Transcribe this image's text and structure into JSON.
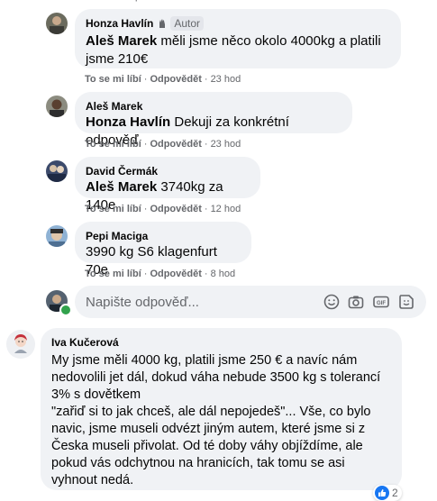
{
  "top_fragment": "p",
  "comments": [
    {
      "author": "Honza Havlín",
      "badge": "Autor",
      "mention": "Aleš Marek",
      "text": "měli jsme něco okolo 4000kg a platili jsme 210€",
      "like": "To se mi líbí",
      "reply": "Odpovědět",
      "time": "23 hod"
    },
    {
      "author": "Aleš Marek",
      "mention": "Honza Havlín",
      "text": "Dekuji za konkrétní odpověď",
      "like": "To se mi líbí",
      "reply": "Odpovědět",
      "time": "23 hod"
    },
    {
      "author": "David Čermák",
      "mention": "Aleš Marek",
      "text": "3740kg za 140e",
      "like": "To se mi líbí",
      "reply": "Odpovědět",
      "time": "12 hod"
    },
    {
      "author": "Pepi Maciga",
      "text": "3990 kg S6 klagenfurt 70e",
      "like": "To se mi líbí",
      "reply": "Odpovědět",
      "time": "8 hod"
    }
  ],
  "reply_box": {
    "placeholder": "Napište odpověď...",
    "icons": [
      "emoji-icon",
      "camera-icon",
      "gif-icon",
      "sticker-icon"
    ]
  },
  "main_comment": {
    "author": "Iva Kučerová",
    "lines": [
      "My jsme měli 4000 kg, platili jsme 250 € a navíc nám",
      "nedovolili jet dál, dokud váha nebude 3500 kg s tolerancí",
      "3% s dovětkem",
      "\"zařiď si to jak chceš, ale dál nepojedeš\"... Vše, co bylo",
      "navic, jsme museli odvézt jiným autem, které jsme si z",
      "Česka museli přivolat. Od té doby váhy objíždíme, ale",
      "pokud vás odchytnou na hranicích, tak tomu se asi",
      "vyhnout nedá."
    ],
    "reaction_count": "2"
  },
  "colors": {
    "bubble": "#f0f2f5",
    "secondary_text": "#65676b",
    "like_blue": "#1877f2",
    "online_green": "#31a24c"
  }
}
